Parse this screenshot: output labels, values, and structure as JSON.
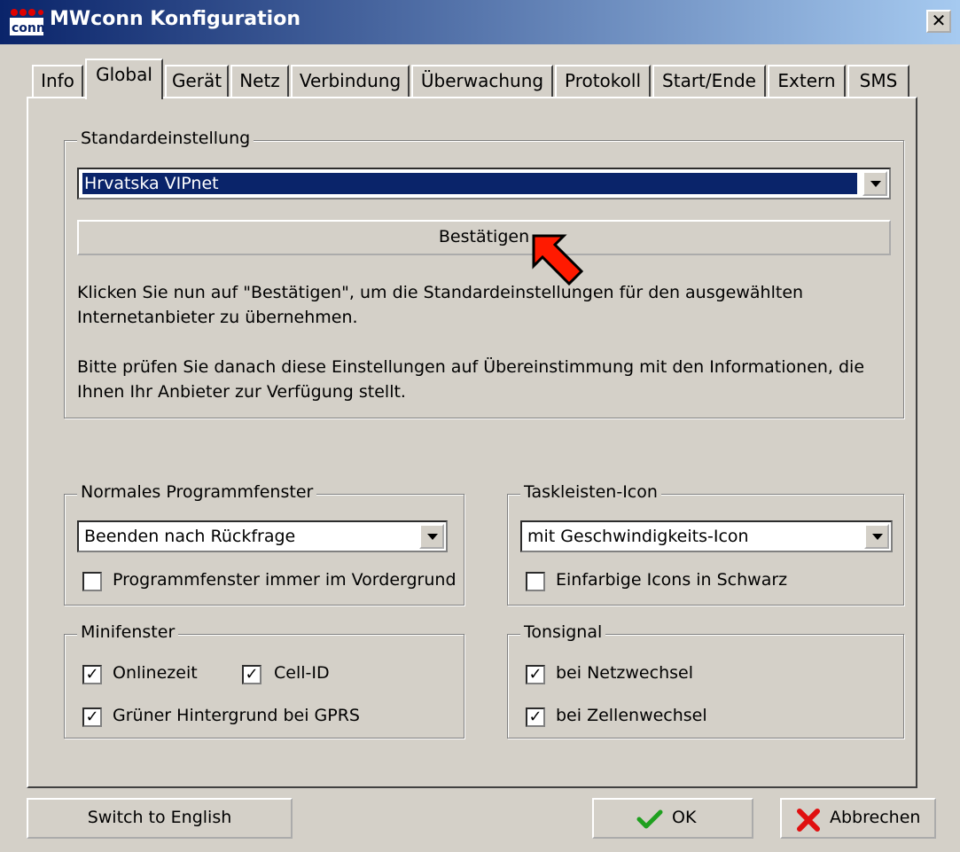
{
  "window": {
    "title": "MWconn Konfiguration",
    "close_glyph": "✕"
  },
  "tabs": [
    {
      "label": "Info",
      "active": false
    },
    {
      "label": "Global",
      "active": true
    },
    {
      "label": "Gerät",
      "active": false
    },
    {
      "label": "Netz",
      "active": false
    },
    {
      "label": "Verbindung",
      "active": false
    },
    {
      "label": "Überwachung",
      "active": false
    },
    {
      "label": "Protokoll",
      "active": false
    },
    {
      "label": "Start/Ende",
      "active": false
    },
    {
      "label": "Extern",
      "active": false
    },
    {
      "label": "SMS",
      "active": false
    }
  ],
  "standard": {
    "legend": "Standardeinstellung",
    "provider_value": "Hrvatska  VIPnet",
    "confirm_label": "Bestätigen",
    "info_line1": "Klicken Sie nun auf \"Bestätigen\", um die Standardeinstellungen für den ausgewählten",
    "info_line2": "Internetanbieter zu übernehmen.",
    "info_line3": "Bitte prüfen Sie danach diese Einstellungen auf Übereinstimmung mit den Informationen, die",
    "info_line4": "Ihnen Ihr Anbieter zur Verfügung stellt."
  },
  "program_window": {
    "legend": "Normales Programmfenster",
    "select_value": "Beenden nach Rückfrage",
    "always_on_top_label": "Programmfenster immer im Vordergrund",
    "always_on_top_checked": false
  },
  "taskbar": {
    "legend": "Taskleisten-Icon",
    "select_value": "mit Geschwindigkeits-Icon",
    "mono_icons_label": "Einfarbige Icons in Schwarz",
    "mono_icons_checked": false
  },
  "mini_window": {
    "legend": "Minifenster",
    "online_time_label": "Onlinezeit",
    "online_time_checked": true,
    "cell_id_label": "Cell-ID",
    "cell_id_checked": true,
    "green_bg_label": "Grüner Hintergrund bei GPRS",
    "green_bg_checked": true
  },
  "tone": {
    "legend": "Tonsignal",
    "network_change_label": "bei Netzwechsel",
    "network_change_checked": true,
    "cell_change_label": "bei Zellenwechsel",
    "cell_change_checked": true
  },
  "footer": {
    "switch_english_label": "Switch to English",
    "ok_label": "OK",
    "cancel_label": "Abbrechen"
  },
  "colors": {
    "title_start": "#0a246a",
    "title_end": "#a6caf0",
    "face": "#d4d0c8",
    "ok_green": "#1fa01f",
    "cancel_red": "#e01010",
    "cursor_red": "#ff1a00"
  },
  "icons": {
    "app": "mwconn-app-icon",
    "check": "check-icon",
    "cross": "cross-icon",
    "cursor": "arrow-cursor-icon"
  }
}
